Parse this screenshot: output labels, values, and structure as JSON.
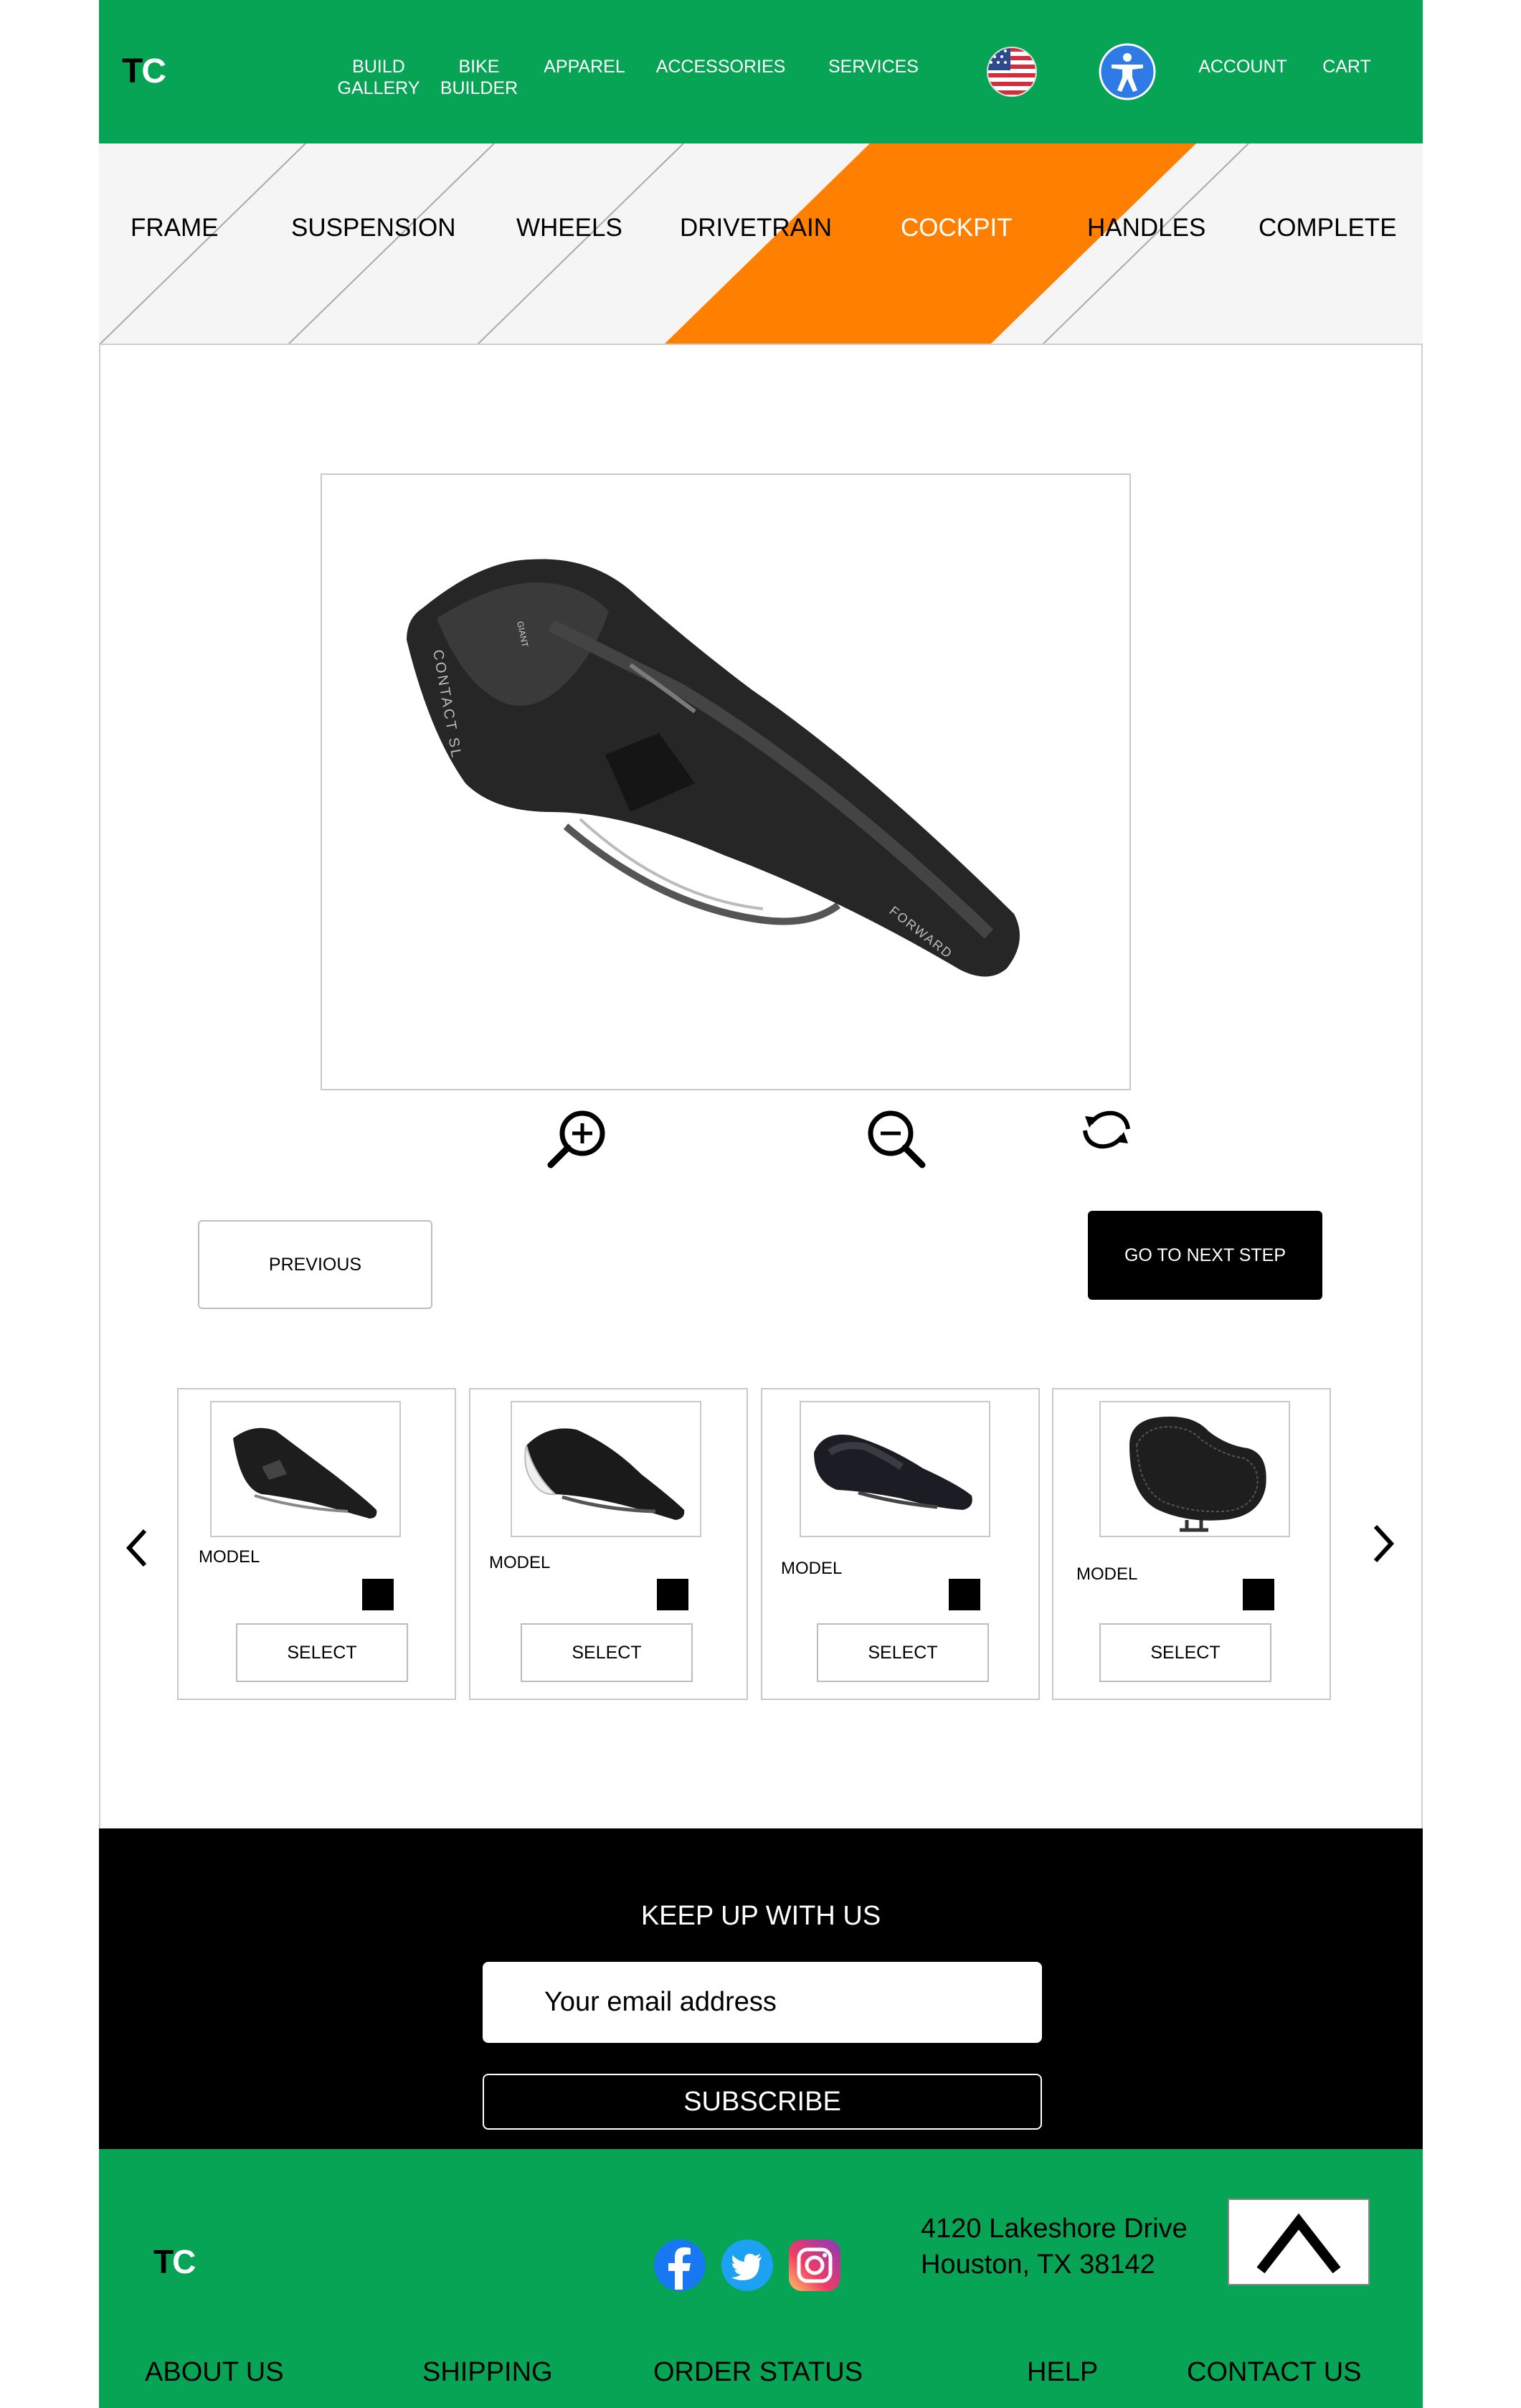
{
  "header": {
    "logo": {
      "t": "T",
      "c": "C"
    },
    "nav": [
      {
        "line1": "BUILD",
        "line2": "GALLERY"
      },
      {
        "line1": "BIKE",
        "line2": "BUILDER"
      },
      {
        "line1": "APPAREL",
        "line2": ""
      },
      {
        "line1": "ACCESSORIES",
        "line2": ""
      },
      {
        "line1": "SERVICES",
        "line2": ""
      }
    ],
    "account": "ACCOUNT",
    "cart": "CART"
  },
  "steps": [
    "FRAME",
    "SUSPENSION",
    "WHEELS",
    "DRIVETRAIN",
    "COCKPIT",
    "HANDLES",
    "COMPLETE"
  ],
  "active_step": "COCKPIT",
  "colors": {
    "brand_green": "#07a456",
    "active_step": "#ff7f00",
    "black": "#000000"
  },
  "viewer": {
    "saddle_text_1": "CONTACT SL",
    "saddle_text_2": "FORWARD",
    "saddle_text_3": "GIANT",
    "tools": [
      "zoom-in-icon",
      "zoom-out-icon",
      "rotate-icon"
    ]
  },
  "buttons": {
    "previous": "PREVIOUS",
    "next": "GO TO NEXT STEP"
  },
  "products": [
    {
      "model": "MODEL",
      "select": "SELECT"
    },
    {
      "model": "MODEL",
      "select": "SELECT"
    },
    {
      "model": "MODEL",
      "select": "SELECT"
    },
    {
      "model": "MODEL",
      "select": "SELECT"
    }
  ],
  "newsletter": {
    "title": "KEEP UP WITH US",
    "placeholder": "Your email address",
    "subscribe": "SUBSCRIBE"
  },
  "footer": {
    "logo": {
      "t": "T",
      "c": "C"
    },
    "address_line1": "4120 Lakeshore Drive",
    "address_line2": "Houston, TX 38142",
    "links": [
      "ABOUT US",
      "SHIPPING",
      "ORDER STATUS",
      "HELP",
      "CONTACT US"
    ],
    "social": [
      "facebook-icon",
      "twitter-icon",
      "instagram-icon"
    ]
  }
}
